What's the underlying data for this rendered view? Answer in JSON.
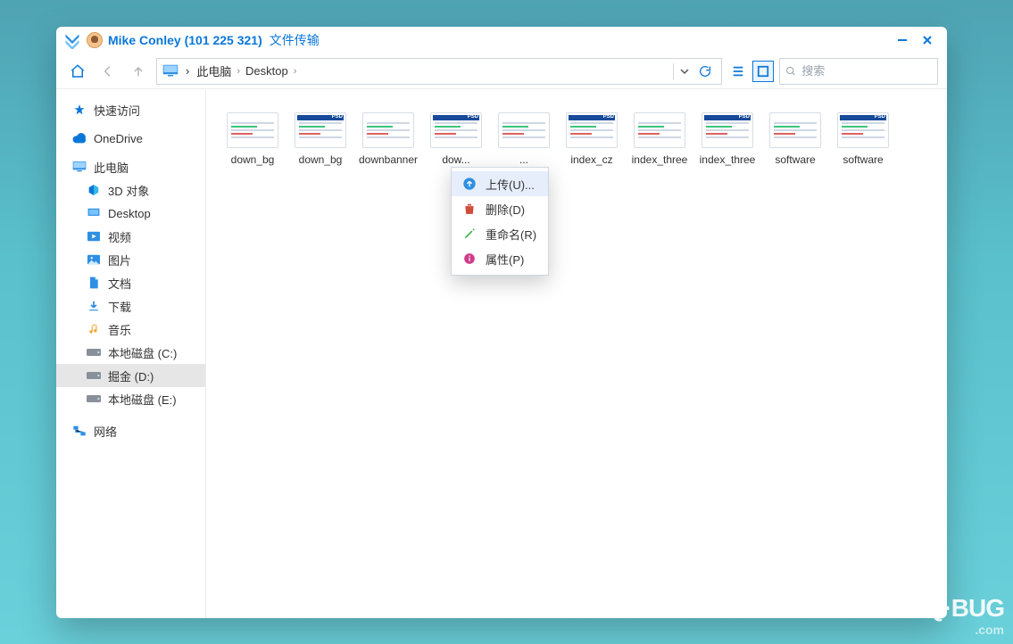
{
  "titlebar": {
    "name": "Mike Conley (101 225 321)",
    "mode": "文件传输"
  },
  "breadcrumb": [
    "此电脑",
    "Desktop"
  ],
  "search": {
    "placeholder": "搜索"
  },
  "sidebar": {
    "quick_access": "快速访问",
    "onedrive": "OneDrive",
    "this_pc": "此电脑",
    "children": [
      {
        "label": "3D 对象"
      },
      {
        "label": "Desktop"
      },
      {
        "label": "视频"
      },
      {
        "label": "图片"
      },
      {
        "label": "文档"
      },
      {
        "label": "下载"
      },
      {
        "label": "音乐"
      },
      {
        "label": "本地磁盘 (C:)"
      },
      {
        "label": "掘金 (D:)"
      },
      {
        "label": "本地磁盘 (E:)"
      }
    ],
    "network": "网络"
  },
  "files": [
    {
      "name": "down_bg",
      "psd": false
    },
    {
      "name": "down_bg",
      "psd": true
    },
    {
      "name": "downbanner",
      "psd": false
    },
    {
      "name": "dow...",
      "psd": true
    },
    {
      "name": "...",
      "psd": false
    },
    {
      "name": "index_cz",
      "psd": true
    },
    {
      "name": "index_three",
      "psd": false
    },
    {
      "name": "index_three",
      "psd": true
    },
    {
      "name": "software",
      "psd": false
    },
    {
      "name": "software",
      "psd": true
    }
  ],
  "context_menu": {
    "upload": "上传(U)...",
    "delete": "删除(D)",
    "rename": "重命名(R)",
    "properties": "属性(P)"
  },
  "watermark": {
    "main": "Q·BUG",
    "sub": ".com"
  }
}
